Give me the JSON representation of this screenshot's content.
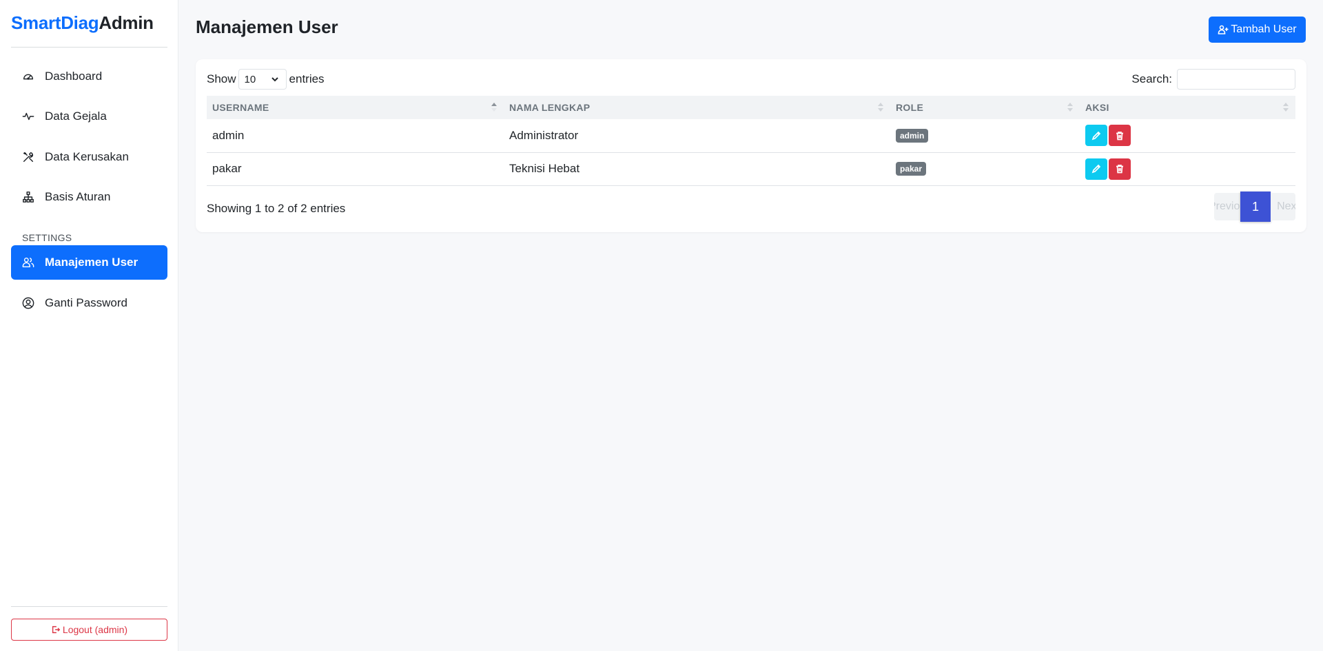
{
  "brand": {
    "part1": "SmartDiag",
    "part2": "Admin"
  },
  "sidebar": {
    "items": [
      {
        "label": "Dashboard",
        "icon": "gauge-icon"
      },
      {
        "label": "Data Gejala",
        "icon": "activity-icon"
      },
      {
        "label": "Data Kerusakan",
        "icon": "tools-icon"
      },
      {
        "label": "Basis Aturan",
        "icon": "diagram-icon"
      }
    ],
    "section_label": "SETTINGS",
    "settings_items": [
      {
        "label": "Manajemen User",
        "icon": "users-icon",
        "active": true
      },
      {
        "label": "Ganti Password",
        "icon": "user-circle-icon"
      }
    ],
    "logout_label": "Logout (admin)"
  },
  "header": {
    "title": "Manajemen User",
    "add_button_label": "Tambah User"
  },
  "table_controls": {
    "show_label": "Show",
    "entries_value": "10",
    "entries_label": "entries",
    "search_label": "Search:",
    "search_value": ""
  },
  "table": {
    "columns": [
      "USERNAME",
      "NAMA LENGKAP",
      "ROLE",
      "AKSI"
    ],
    "rows": [
      {
        "username": "admin",
        "nama_lengkap": "Administrator",
        "role": "admin"
      },
      {
        "username": "pakar",
        "nama_lengkap": "Teknisi Hebat",
        "role": "pakar"
      }
    ]
  },
  "footer": {
    "info": "Showing 1 to 2 of 2 entries",
    "prev_label": "Previous",
    "current_page": "1",
    "next_label": "Next"
  },
  "colors": {
    "primary": "#0d6efd",
    "danger": "#dc3545",
    "info": "#0dcaf0",
    "badge": "#6c757d",
    "page_active": "#3d52d5"
  }
}
